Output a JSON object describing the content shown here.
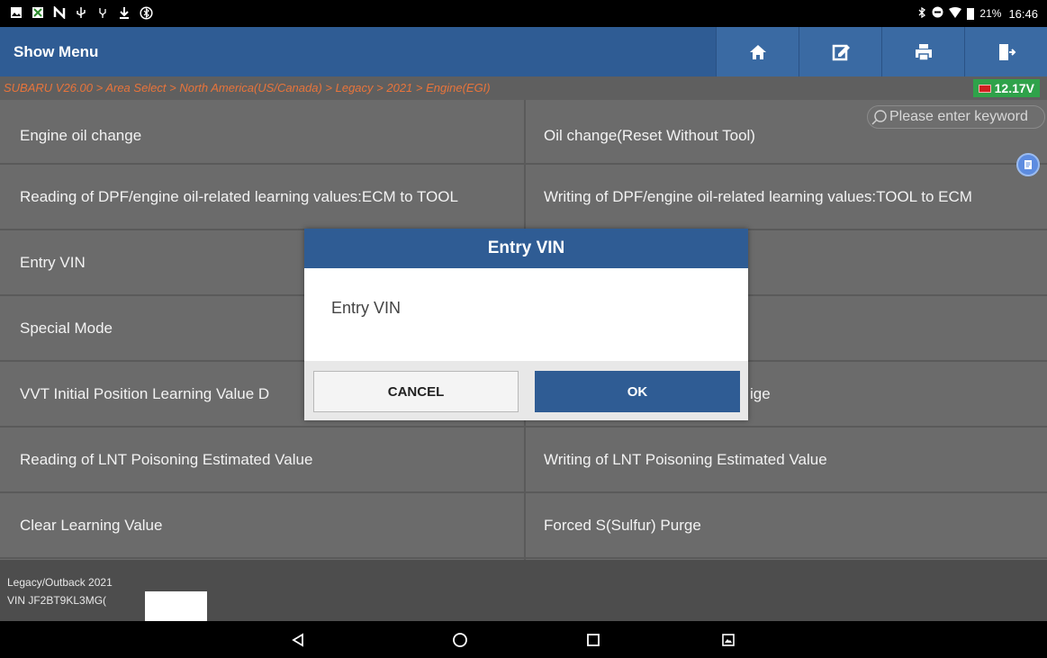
{
  "status_bar": {
    "left_icons": [
      "gallery-icon",
      "app-icon",
      "n-icon",
      "usb-icon",
      "usb-debug-icon",
      "download-icon",
      "bluetooth-setting-icon"
    ],
    "right_text": "21%",
    "time": "16:46"
  },
  "appbar": {
    "title": "Show Menu",
    "buttons": [
      "home-icon",
      "edit-icon",
      "print-icon",
      "exit-icon"
    ]
  },
  "breadcrumb": "SUBARU V26.00 > Area Select > North America(US/Canada) > Legacy > 2021 > Engine(EGI)",
  "voltage": "12.17V",
  "search": {
    "placeholder": "Please enter keyword"
  },
  "menu": {
    "rows": [
      {
        "left": "Engine oil change",
        "right": "Oil change(Reset Without Tool)"
      },
      {
        "left": "Reading of DPF/engine oil-related learning values:ECM to TOOL",
        "right": "Writing of DPF/engine oil-related learning values:TOOL to ECM"
      },
      {
        "left": "Entry VIN",
        "right": ""
      },
      {
        "left": "Special Mode",
        "right": ""
      },
      {
        "left": "VVT Initial Position Learning Value D",
        "right": "ige"
      },
      {
        "left": "Reading of LNT Poisoning Estimated Value",
        "right": "Writing of LNT Poisoning Estimated Value"
      },
      {
        "left": "Clear Learning Value",
        "right": "Forced S(Sulfur) Purge"
      }
    ]
  },
  "dialog": {
    "title": "Entry VIN",
    "message": "Entry VIN",
    "cancel_label": "CANCEL",
    "ok_label": "OK"
  },
  "vehicle_info": {
    "model": "Legacy/Outback 2021",
    "vin": "VIN JF2BT9KL3MG("
  },
  "colors": {
    "primary": "#2f5c94",
    "breadcrumb_text": "#e8743b",
    "voltage_bg": "#2fa24a",
    "list_bg": "#6b6b6b"
  }
}
